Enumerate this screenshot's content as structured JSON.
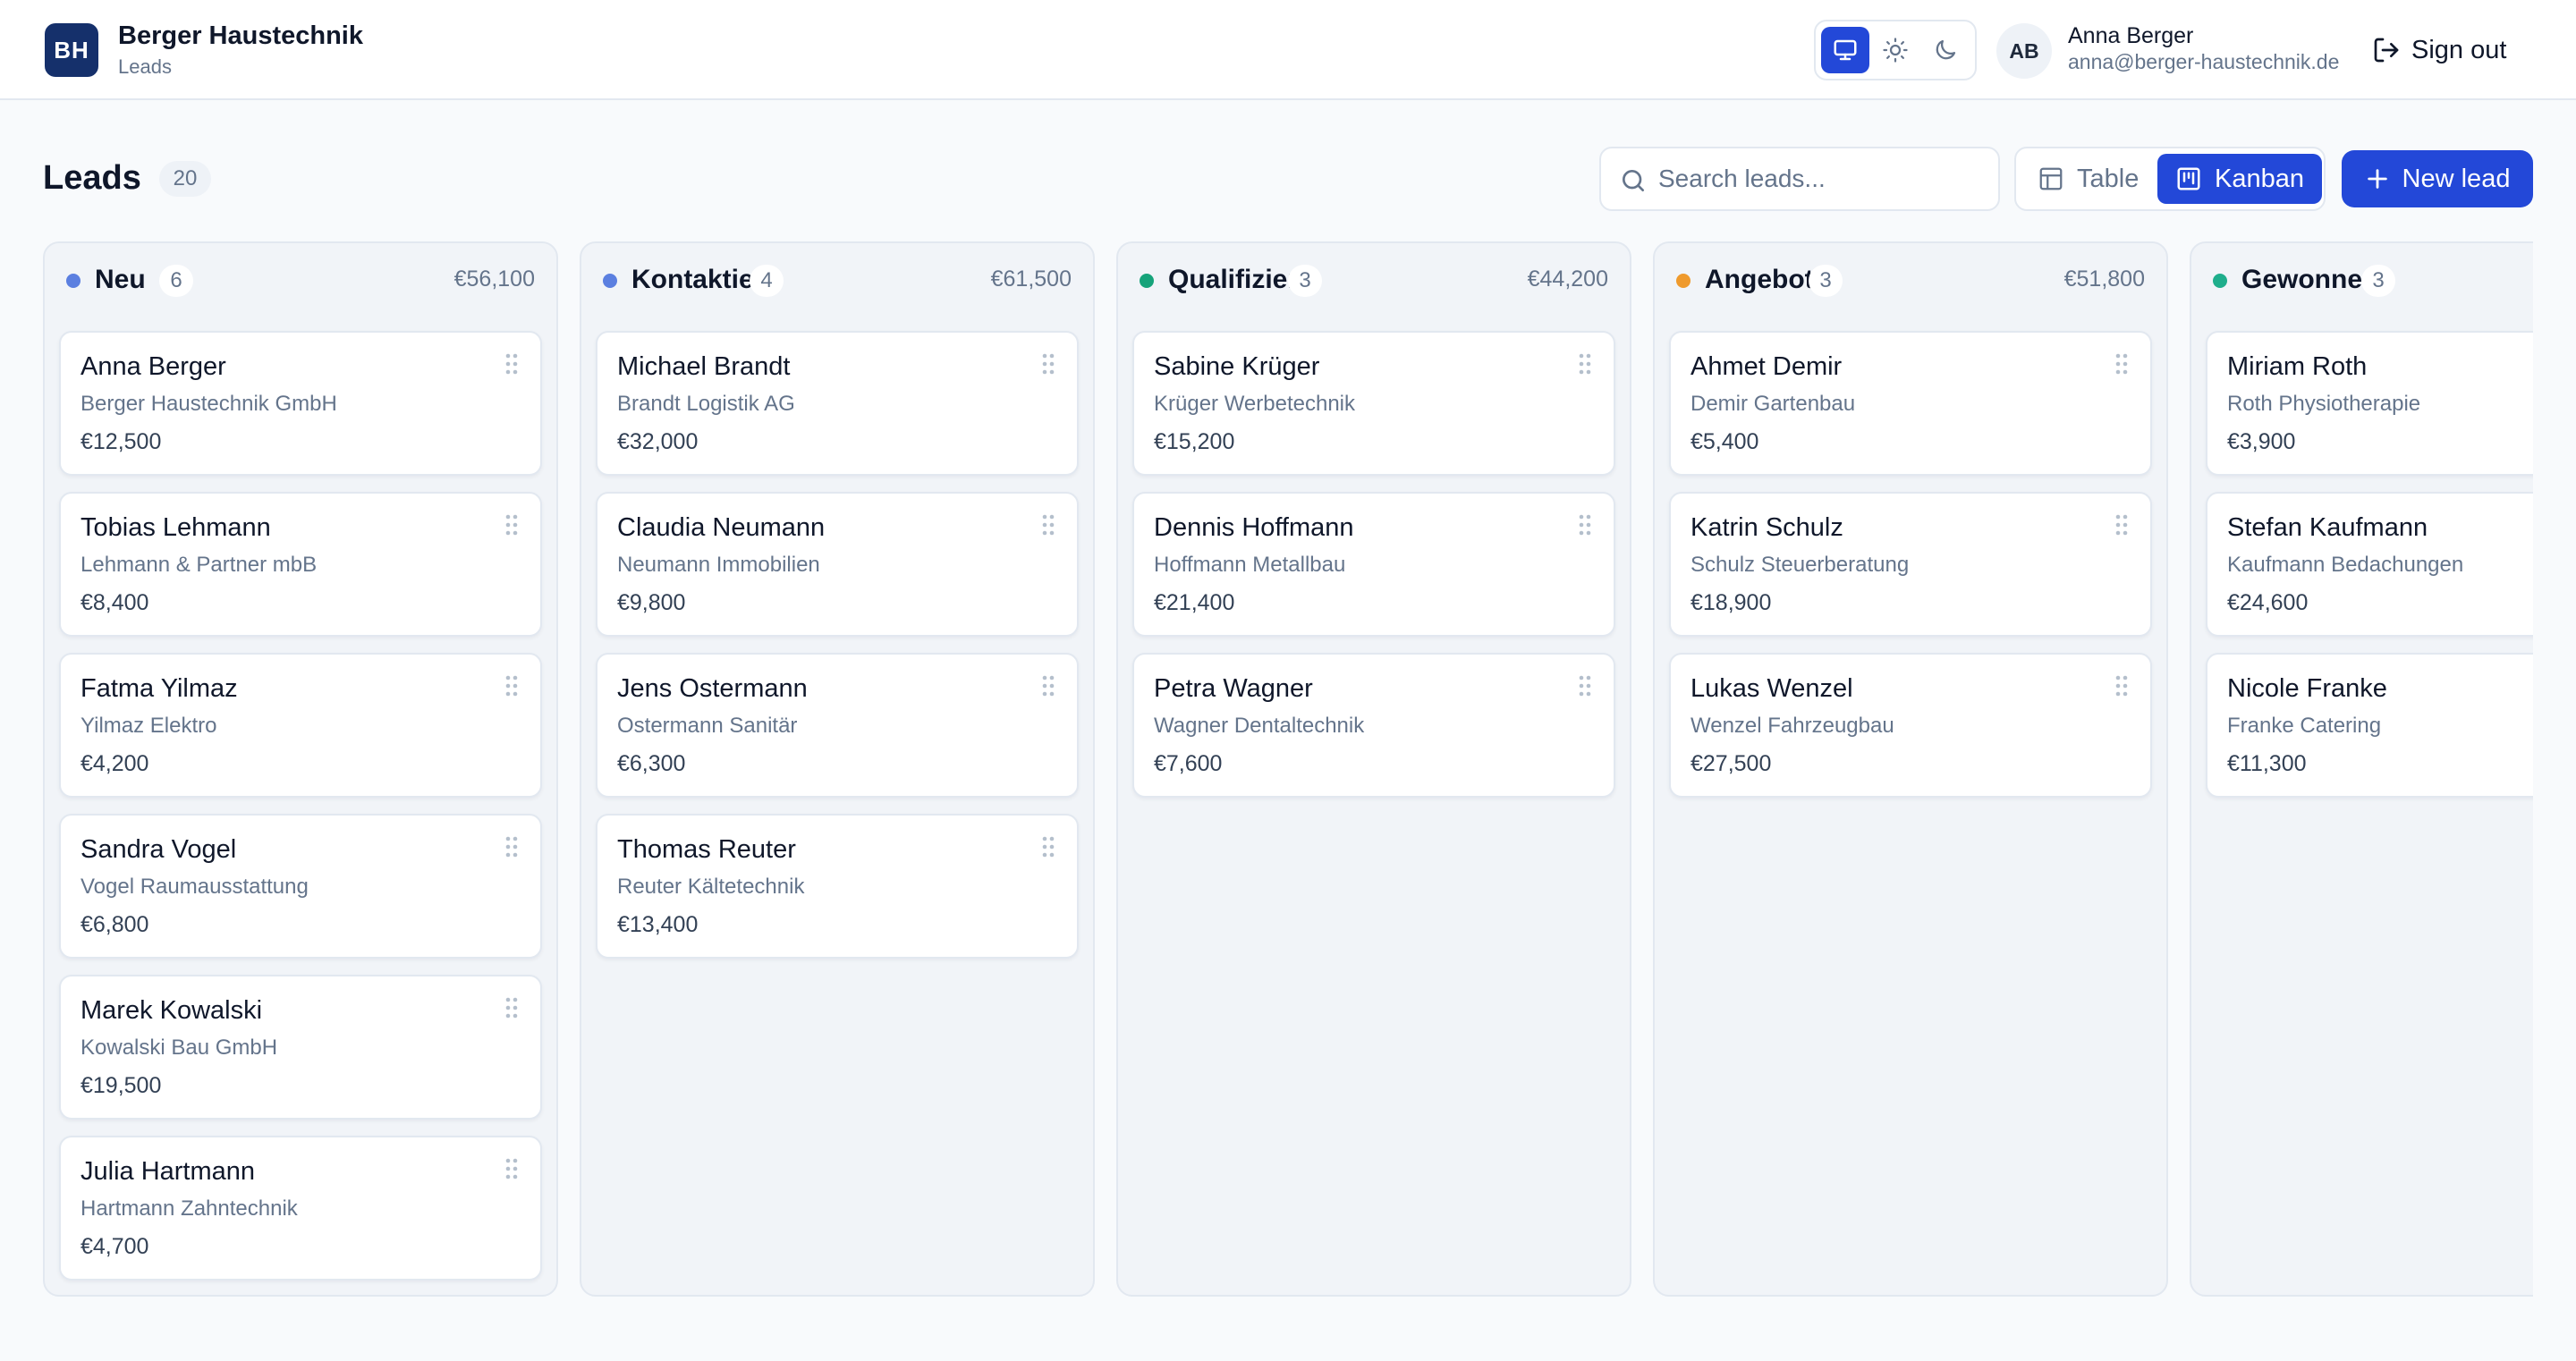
{
  "app": {
    "logo": "BH",
    "title": "Berger Haustechnik",
    "subtitle": "Leads"
  },
  "theme_toggle": {
    "options": [
      "monitor-icon",
      "sun-icon",
      "moon-icon"
    ],
    "active": "monitor-icon"
  },
  "user": {
    "initials": "AB",
    "name": "Anna Berger",
    "email": "anna@berger-haustechnik.de",
    "sign_out_label": "Sign out"
  },
  "toolbar": {
    "title": "Leads",
    "count": "20",
    "search_placeholder": "Search leads...",
    "search_value": "",
    "view_table_label": "Table",
    "view_kanban_label": "Kanban",
    "active_view": "Kanban",
    "new_lead_label": "New lead"
  },
  "colors": {
    "accent": "#2348d8",
    "logo_bg": "#15306b"
  },
  "columns": [
    {
      "title": "Neu",
      "count": "6",
      "total": "€56,100",
      "dot_color": "#5b7fe0",
      "cards": [
        {
          "name": "Anna Berger",
          "company": "Berger Haustechnik GmbH",
          "value": "€12,500"
        },
        {
          "name": "Tobias Lehmann",
          "company": "Lehmann & Partner mbB",
          "value": "€8,400"
        },
        {
          "name": "Fatma Yilmaz",
          "company": "Yilmaz Elektro",
          "value": "€4,200"
        },
        {
          "name": "Sandra Vogel",
          "company": "Vogel Raumausstattung",
          "value": "€6,800"
        },
        {
          "name": "Marek Kowalski",
          "company": "Kowalski Bau GmbH",
          "value": "€19,500"
        },
        {
          "name": "Julia Hartmann",
          "company": "Hartmann Zahntechnik",
          "value": "€4,700"
        }
      ]
    },
    {
      "title": "Kontaktiert",
      "count": "4",
      "total": "€61,500",
      "dot_color": "#5b7fe0",
      "cards": [
        {
          "name": "Michael Brandt",
          "company": "Brandt Logistik AG",
          "value": "€32,000"
        },
        {
          "name": "Claudia Neumann",
          "company": "Neumann Immobilien",
          "value": "€9,800"
        },
        {
          "name": "Jens Ostermann",
          "company": "Ostermann Sanitär",
          "value": "€6,300"
        },
        {
          "name": "Thomas Reuter",
          "company": "Reuter Kältetechnik",
          "value": "€13,400"
        }
      ]
    },
    {
      "title": "Qualifiziert",
      "count": "3",
      "total": "€44,200",
      "dot_color": "#16a37a",
      "cards": [
        {
          "name": "Sabine Krüger",
          "company": "Krüger Werbetechnik",
          "value": "€15,200"
        },
        {
          "name": "Dennis Hoffmann",
          "company": "Hoffmann Metallbau",
          "value": "€21,400"
        },
        {
          "name": "Petra Wagner",
          "company": "Wagner Dentaltechnik",
          "value": "€7,600"
        }
      ]
    },
    {
      "title": "Angebot",
      "count": "3",
      "total": "€51,800",
      "dot_color": "#ef9a2d",
      "cards": [
        {
          "name": "Ahmet Demir",
          "company": "Demir Gartenbau",
          "value": "€5,400"
        },
        {
          "name": "Katrin Schulz",
          "company": "Schulz Steuerberatung",
          "value": "€18,900"
        },
        {
          "name": "Lukas Wenzel",
          "company": "Wenzel Fahrzeugbau",
          "value": "€27,500"
        }
      ]
    },
    {
      "title": "Gewonnen",
      "count": "3",
      "total": "",
      "dot_color": "#1fae8c",
      "cards": [
        {
          "name": "Miriam Roth",
          "company": "Roth Physiotherapie",
          "value": "€3,900"
        },
        {
          "name": "Stefan Kaufmann",
          "company": "Kaufmann Bedachungen",
          "value": "€24,600"
        },
        {
          "name": "Nicole Franke",
          "company": "Franke Catering",
          "value": "€11,300"
        }
      ]
    }
  ]
}
